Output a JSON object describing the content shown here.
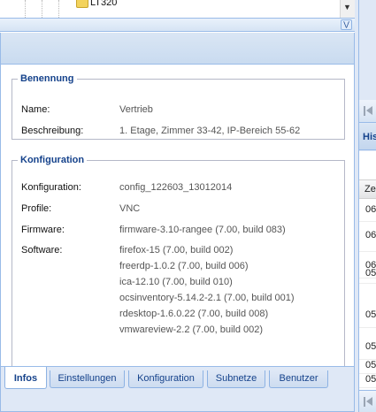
{
  "tree": {
    "visible_item_label": "LT320"
  },
  "benennung": {
    "legend": "Benennung",
    "fields": [
      {
        "label": "Name:",
        "value": "Vertrieb"
      },
      {
        "label": "Beschreibung:",
        "value": "1. Etage, Zimmer 33-42, IP-Bereich 55-62"
      }
    ]
  },
  "konfiguration": {
    "legend": "Konfiguration",
    "fields": [
      {
        "label": "Konfiguration:",
        "value": "config_122603_13012014"
      },
      {
        "label": "Profile:",
        "value": "VNC"
      },
      {
        "label": "Firmware:",
        "value": "firmware-3.10-rangee (7.00, build 083)"
      }
    ],
    "software_label": "Software:",
    "software": [
      "firefox-15 (7.00, build 002)",
      "freerdp-1.0.2 (7.00, build 006)",
      "ica-12.10 (7.00, build 010)",
      "ocsinventory-5.14.2-2.1 (7.00, build 001)",
      "rdesktop-1.6.0.22 (7.00, build 008)",
      "vmwareview-2.2 (7.00, build 002)"
    ]
  },
  "tabs": [
    {
      "label": "Infos",
      "active": true
    },
    {
      "label": "Einstellungen",
      "active": false
    },
    {
      "label": "Konfiguration",
      "active": false
    },
    {
      "label": "Subnetze",
      "active": false
    },
    {
      "label": "Benutzer",
      "active": false
    }
  ],
  "right_panel": {
    "title_fragment": "His",
    "column_header_fragment": "Ze",
    "cells": [
      "06",
      "06",
      "06",
      "05",
      "05",
      "05",
      "05",
      "05"
    ]
  },
  "colors": {
    "accent_blue": "#15428b",
    "panel_border": "#99bbe8",
    "header_bg": "#dfe8f6"
  }
}
